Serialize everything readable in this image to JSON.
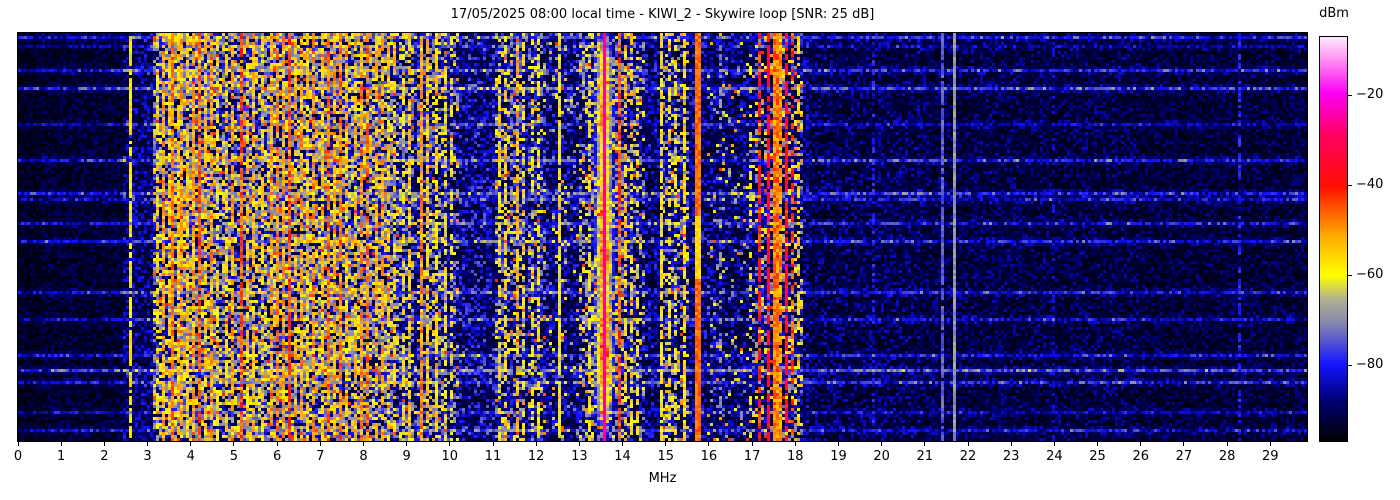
{
  "title": "17/05/2025 08:00 local time - KIWI_2 - Skywire loop [SNR: 25 dB]",
  "xlabel": "MHz",
  "x_ticks": [
    "0",
    "1",
    "2",
    "3",
    "4",
    "5",
    "6",
    "7",
    "8",
    "9",
    "10",
    "11",
    "12",
    "13",
    "14",
    "15",
    "16",
    "17",
    "18",
    "19",
    "20",
    "21",
    "22",
    "23",
    "24",
    "25",
    "26",
    "27",
    "28",
    "29"
  ],
  "colorbar": {
    "label": "dBm",
    "ticks": [
      "−20",
      "−40",
      "−60",
      "−80"
    ],
    "tick_values": [
      -20,
      -40,
      -60,
      -80
    ],
    "vmax": -7,
    "vmin": -97,
    "gradient": [
      {
        "pos": 0.0,
        "color": "#000000"
      },
      {
        "pos": 0.1,
        "color": "#000075"
      },
      {
        "pos": 0.19,
        "color": "#1414ff"
      },
      {
        "pos": 0.29,
        "color": "#8585ae"
      },
      {
        "pos": 0.35,
        "color": "#b0b092"
      },
      {
        "pos": 0.41,
        "color": "#ffff00"
      },
      {
        "pos": 0.51,
        "color": "#ffa800"
      },
      {
        "pos": 0.63,
        "color": "#ff0f00"
      },
      {
        "pos": 0.76,
        "color": "#ff0064"
      },
      {
        "pos": 0.86,
        "color": "#fb00f5"
      },
      {
        "pos": 0.95,
        "color": "#ff9af2"
      },
      {
        "pos": 1.0,
        "color": "#ffeaff"
      }
    ]
  },
  "chart_data": {
    "type": "heatmap",
    "subtype": "hf-spectrogram-waterfall",
    "x_range_mhz": [
      0,
      29.85
    ],
    "x_ticks_mhz": [
      0,
      1,
      2,
      3,
      4,
      5,
      6,
      7,
      8,
      9,
      10,
      11,
      12,
      13,
      14,
      15,
      16,
      17,
      18,
      19,
      20,
      21,
      22,
      23,
      24,
      25,
      26,
      27,
      28,
      29
    ],
    "value_unit": "dBm",
    "value_range_dbm": [
      -97,
      -7
    ],
    "noise_profile": [
      [
        0,
        0.04
      ],
      [
        0.5,
        0.055
      ],
      [
        2.4,
        0.11
      ],
      [
        3.1,
        0.17
      ],
      [
        9.2,
        0.14
      ],
      [
        12.3,
        0.12
      ],
      [
        16,
        0.11
      ],
      [
        18.3,
        0.085
      ],
      [
        21,
        0.075
      ],
      [
        26,
        0.065
      ]
    ],
    "noise_bands": [
      [
        3.1,
        3.5,
        0.45
      ],
      [
        3.5,
        4.65,
        0.58
      ],
      [
        4.65,
        5.1,
        0.42
      ],
      [
        5.2,
        5.65,
        0.48
      ],
      [
        5.7,
        6.45,
        0.55
      ],
      [
        6.45,
        7.05,
        0.48
      ],
      [
        7.05,
        7.6,
        0.52
      ],
      [
        7.6,
        8.75,
        0.52
      ],
      [
        8.75,
        9.15,
        0.32
      ],
      [
        9.25,
        9.95,
        0.38
      ],
      [
        10.0,
        10.2,
        0.25
      ],
      [
        11.05,
        11.75,
        0.33
      ],
      [
        11.8,
        12.2,
        0.22
      ],
      [
        12.3,
        12.95,
        0.1
      ],
      [
        13.0,
        14.05,
        0.4
      ],
      [
        14.05,
        14.5,
        0.25
      ],
      [
        14.95,
        15.55,
        0.27
      ],
      [
        15.95,
        17.05,
        0.1
      ],
      [
        17.05,
        18.2,
        0.3
      ]
    ],
    "carriers": [
      [
        2.57,
        0.42,
        0.8
      ],
      [
        3.2,
        0.44,
        0.5
      ],
      [
        3.33,
        0.5,
        0.75
      ],
      [
        3.45,
        0.46,
        0.6
      ],
      [
        3.57,
        0.53,
        0.85
      ],
      [
        3.68,
        0.46,
        0.6
      ],
      [
        3.78,
        0.5,
        0.7
      ],
      [
        3.9,
        0.46,
        0.65
      ],
      [
        4.05,
        0.5,
        0.75
      ],
      [
        4.2,
        0.56,
        0.92
      ],
      [
        4.33,
        0.46,
        0.6
      ],
      [
        4.47,
        0.52,
        0.7
      ],
      [
        4.62,
        0.44,
        0.55
      ],
      [
        4.8,
        0.46,
        0.6
      ],
      [
        4.95,
        0.5,
        0.65
      ],
      [
        5.15,
        0.57,
        0.93
      ],
      [
        5.3,
        0.46,
        0.55
      ],
      [
        5.45,
        0.48,
        0.6
      ],
      [
        5.62,
        0.44,
        0.5
      ],
      [
        5.85,
        0.5,
        0.7
      ],
      [
        6.0,
        0.52,
        0.75
      ],
      [
        6.12,
        0.5,
        0.7
      ],
      [
        6.25,
        0.57,
        0.9
      ],
      [
        6.4,
        0.48,
        0.6
      ],
      [
        6.55,
        0.5,
        0.65
      ],
      [
        6.7,
        0.46,
        0.55
      ],
      [
        6.85,
        0.52,
        0.7
      ],
      [
        7.0,
        0.46,
        0.6
      ],
      [
        7.2,
        0.55,
        0.85
      ],
      [
        7.32,
        0.5,
        0.7
      ],
      [
        7.45,
        0.54,
        0.8
      ],
      [
        7.6,
        0.46,
        0.6
      ],
      [
        7.78,
        0.48,
        0.65
      ],
      [
        7.95,
        0.52,
        0.7
      ],
      [
        8.1,
        0.54,
        0.78
      ],
      [
        8.25,
        0.48,
        0.62
      ],
      [
        8.4,
        0.5,
        0.68
      ],
      [
        8.55,
        0.46,
        0.55
      ],
      [
        8.72,
        0.44,
        0.5
      ],
      [
        8.9,
        0.42,
        0.5
      ],
      [
        9.05,
        0.46,
        0.6
      ],
      [
        9.32,
        0.52,
        0.9
      ],
      [
        9.45,
        0.46,
        0.75
      ],
      [
        9.67,
        0.44,
        0.7
      ],
      [
        9.85,
        0.42,
        0.55
      ],
      [
        10.05,
        0.42,
        0.5
      ],
      [
        11.16,
        0.42,
        0.5
      ],
      [
        11.3,
        0.44,
        0.55
      ],
      [
        11.55,
        0.48,
        0.7
      ],
      [
        11.68,
        0.42,
        0.5
      ],
      [
        11.9,
        0.4,
        0.45
      ],
      [
        12.05,
        0.42,
        0.5
      ],
      [
        12.5,
        0.42,
        0.9
      ],
      [
        13.2,
        0.42,
        0.5
      ],
      [
        13.93,
        0.58,
        0.8
      ],
      [
        14.07,
        0.46,
        0.55
      ],
      [
        14.2,
        0.44,
        0.5
      ],
      [
        14.33,
        0.42,
        0.45
      ],
      [
        14.87,
        0.42,
        0.75
      ],
      [
        15.1,
        0.42,
        0.5
      ],
      [
        15.25,
        0.4,
        0.45
      ],
      [
        15.44,
        0.44,
        0.8
      ],
      [
        16.3,
        0.3,
        0.25
      ],
      [
        16.95,
        0.4,
        0.3
      ],
      [
        17.22,
        0.62,
        0.7
      ],
      [
        17.38,
        0.7,
        0.8
      ],
      [
        17.5,
        0.54,
        0.97,
        2
      ],
      [
        17.65,
        0.52,
        0.85
      ],
      [
        17.8,
        0.68,
        0.75
      ],
      [
        17.95,
        0.6,
        0.5
      ],
      [
        18.07,
        0.44,
        0.4
      ],
      [
        19.8,
        0.2,
        0.35
      ],
      [
        21.42,
        0.25,
        0.9
      ],
      [
        21.7,
        0.31,
        0.95
      ],
      [
        24.0,
        0.16,
        0.3
      ],
      [
        28.3,
        0.2,
        0.5
      ]
    ],
    "broadband_rows": [
      [
        0.005,
        0.12
      ],
      [
        0.03,
        0.06
      ],
      [
        0.091,
        0.13
      ],
      [
        0.135,
        0.15
      ],
      [
        0.225,
        0.08
      ],
      [
        0.31,
        0.12
      ],
      [
        0.39,
        0.13
      ],
      [
        0.405,
        0.1
      ],
      [
        0.47,
        0.11
      ],
      [
        0.512,
        0.12
      ],
      [
        0.64,
        0.12
      ],
      [
        0.7,
        0.1
      ],
      [
        0.79,
        0.11
      ],
      [
        0.83,
        0.16
      ],
      [
        0.86,
        0.12
      ],
      [
        0.93,
        0.08
      ],
      [
        0.975,
        0.1
      ]
    ],
    "special": {
      "pink_line": {
        "mhz": 13.56,
        "amp": 0.8
      },
      "glow": {
        "center": 13.56,
        "f0": 13.3,
        "f1": 13.85,
        "sigma_mhz": 0.14,
        "sigma_row": 0.05,
        "base": 0.12,
        "blobs": [
          [
            0.08,
            0.32
          ],
          [
            0.2,
            0.42
          ],
          [
            0.32,
            0.3
          ],
          [
            0.44,
            0.42
          ],
          [
            0.56,
            0.46
          ],
          [
            0.68,
            0.36
          ],
          [
            0.79,
            0.46
          ],
          [
            0.9,
            0.34
          ]
        ]
      },
      "carrier_1572": {
        "mhz": 15.72,
        "amp_hi": 0.56,
        "amp_lo": 0.45,
        "yellow_from": 0.45,
        "yellow_to": 0.6,
        "w": 2
      }
    }
  }
}
